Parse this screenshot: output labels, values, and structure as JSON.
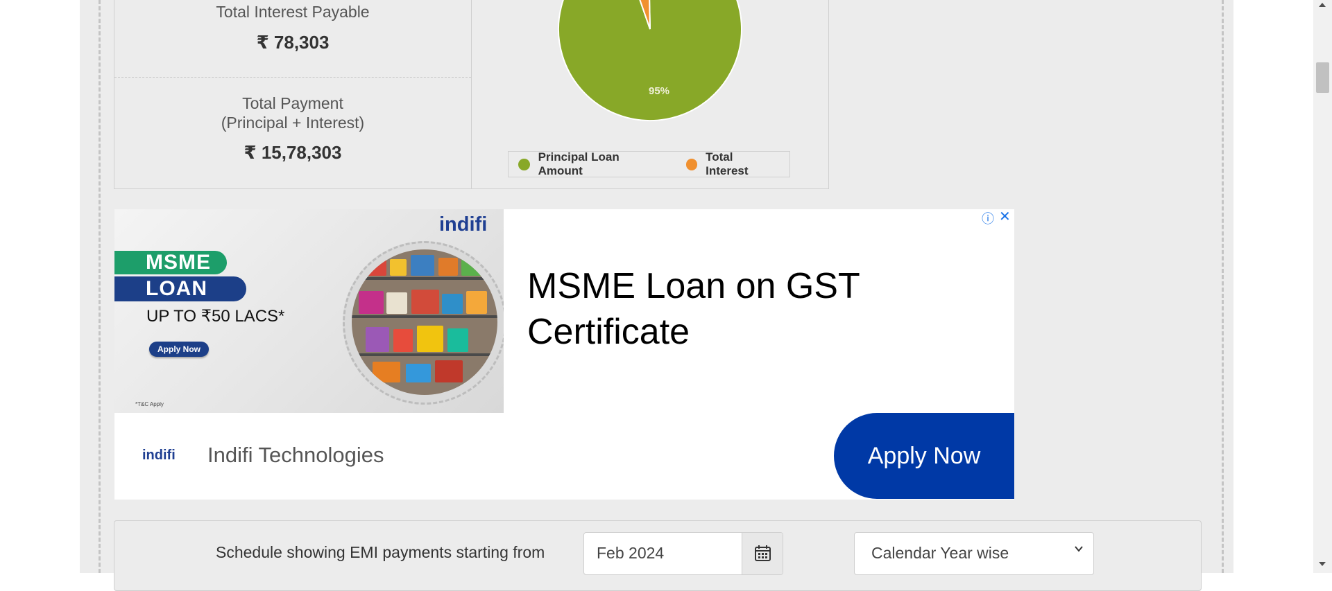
{
  "summary": {
    "interest_label": "Total Interest Payable",
    "interest_value": "₹ 78,303",
    "payment_label_line1": "Total Payment",
    "payment_label_line2": "(Principal + Interest)",
    "payment_value": "₹ 15,78,303"
  },
  "chart_data": {
    "type": "pie",
    "slices": [
      {
        "name": "Principal Loan Amount",
        "value": 95,
        "color": "#88a828",
        "label": "95%"
      },
      {
        "name": "Total Interest",
        "value": 5,
        "color": "#f0902f"
      }
    ],
    "legend_position": "bottom"
  },
  "legend": {
    "principal": "Principal Loan Amount",
    "interest": "Total Interest"
  },
  "ad": {
    "brand": "indifi",
    "pill_msme": "MSME",
    "pill_loan": "LOAN",
    "upto": "UP TO ₹50 LACS*",
    "mini_apply": "Apply Now",
    "tc": "*T&C Apply",
    "headline": "MSME Loan on GST Certificate",
    "advertiser": "Indifi Technologies",
    "cta": "Apply Now",
    "info_icon": "ⓘ",
    "close_icon": "✕",
    "colors": {
      "cta": "#0039a6",
      "brand": "#1f3f92"
    }
  },
  "schedule": {
    "label": "Schedule showing EMI payments starting from",
    "date_value": "Feb 2024",
    "select_value": "Calendar Year wise"
  },
  "icons": {
    "calendar": "calendar-icon",
    "chevron": "chevron-down-icon"
  }
}
